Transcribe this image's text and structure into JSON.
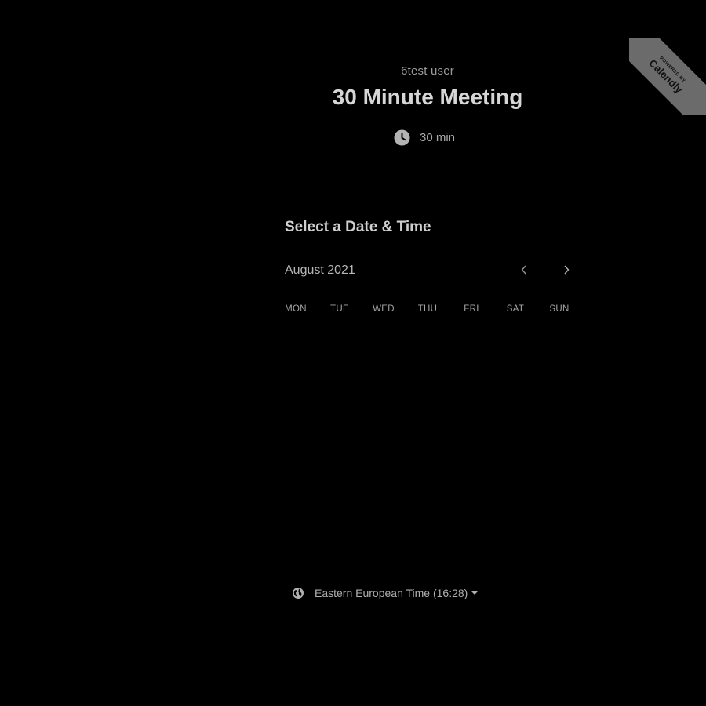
{
  "ribbon": {
    "powered_by": "POWERED BY",
    "brand": "Calendly"
  },
  "header": {
    "organizer": "6test user",
    "event_title": "30 Minute Meeting",
    "duration": "30 min",
    "duration_icon": "clock-icon"
  },
  "calendar": {
    "heading": "Select a Date & Time",
    "month": "August 2021",
    "prev_icon": "chevron-left-icon",
    "next_icon": "chevron-right-icon",
    "weekdays": [
      "MON",
      "TUE",
      "WED",
      "THU",
      "FRI",
      "SAT",
      "SUN"
    ]
  },
  "timezone": {
    "label": "Eastern European Time (16:28)",
    "icon": "globe-icon"
  },
  "colors": {
    "background": "#000000",
    "ribbon": "#6b6b6b",
    "text": "#cfcfcf"
  }
}
